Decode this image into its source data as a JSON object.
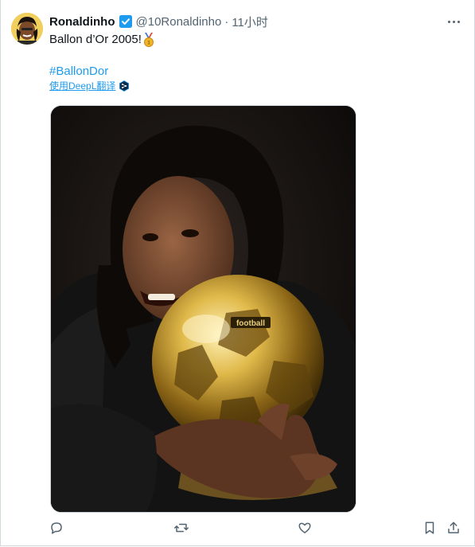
{
  "tweet": {
    "author_name": "Ronaldinho",
    "handle": "@10Ronaldinho",
    "separator": "·",
    "time": "11小时",
    "text": "Ballon d’Or 2005!",
    "hashtag": "#BallonDor",
    "translate_label": "使用DeepL翻译"
  },
  "icons": {
    "verified": "verified-badge-icon",
    "more": "more-dots-icon",
    "medal": "gold-medal-emoji-icon",
    "reply": "reply-icon",
    "retweet": "retweet-icon",
    "like": "like-heart-icon",
    "bookmark": "bookmark-icon",
    "share": "share-icon",
    "deepl": "deepl-icon"
  },
  "colors": {
    "link": "#1d9bf0",
    "secondary_text": "#536471",
    "primary_text": "#0f1419",
    "verified": "#1d9bf0",
    "border": "#cfd9de"
  }
}
